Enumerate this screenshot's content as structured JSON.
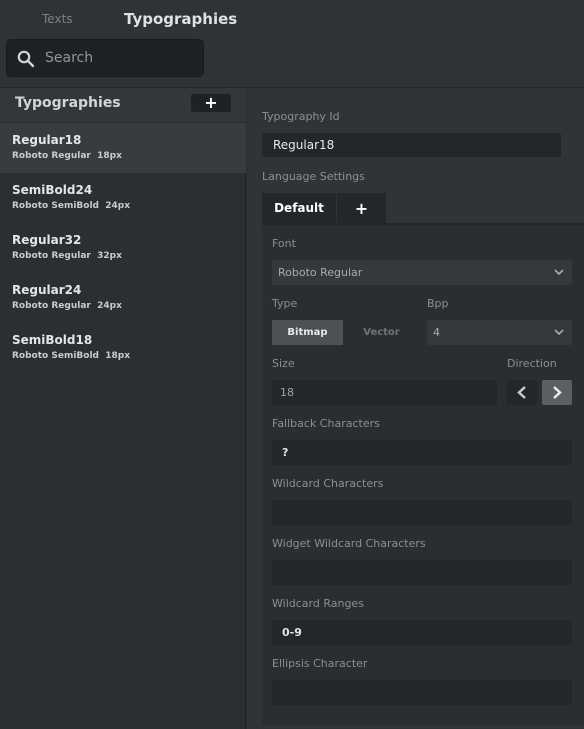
{
  "header": {
    "tabs": [
      "Texts",
      "Typographies"
    ],
    "search_placeholder": "Search"
  },
  "sidebar": {
    "title": "Typographies",
    "add_label": "+",
    "items": [
      {
        "name": "Regular18",
        "font": "Roboto Regular",
        "size": "18px"
      },
      {
        "name": "SemiBold24",
        "font": "Roboto SemiBold",
        "size": "24px"
      },
      {
        "name": "Regular32",
        "font": "Roboto Regular",
        "size": "32px"
      },
      {
        "name": "Regular24",
        "font": "Roboto Regular",
        "size": "24px"
      },
      {
        "name": "SemiBold18",
        "font": "Roboto SemiBold",
        "size": "18px"
      }
    ]
  },
  "detail": {
    "id_label": "Typography Id",
    "id_value": "Regular18",
    "language_label": "Language Settings",
    "language_tabs": [
      "Default",
      "+"
    ],
    "font_label": "Font",
    "font_value": "Roboto Regular",
    "type_label": "Type",
    "type_options": [
      "Bitmap",
      "Vector"
    ],
    "bpp_label": "Bpp",
    "bpp_value": "4",
    "size_label": "Size",
    "size_value": "18",
    "direction_label": "Direction",
    "fallback_label": "Fallback Characters",
    "fallback_value": "?",
    "wildcard_label": "Wildcard Characters",
    "wildcard_value": "",
    "widget_wildcard_label": "Widget Wildcard Characters",
    "widget_wildcard_value": "",
    "wildcard_ranges_label": "Wildcard Ranges",
    "wildcard_ranges_value": "0-9",
    "ellipsis_label": "Ellipsis Character",
    "ellipsis_value": ""
  },
  "colors": {
    "background": "#2b2f33",
    "input": "#24272a",
    "active_item": "#383c40"
  }
}
